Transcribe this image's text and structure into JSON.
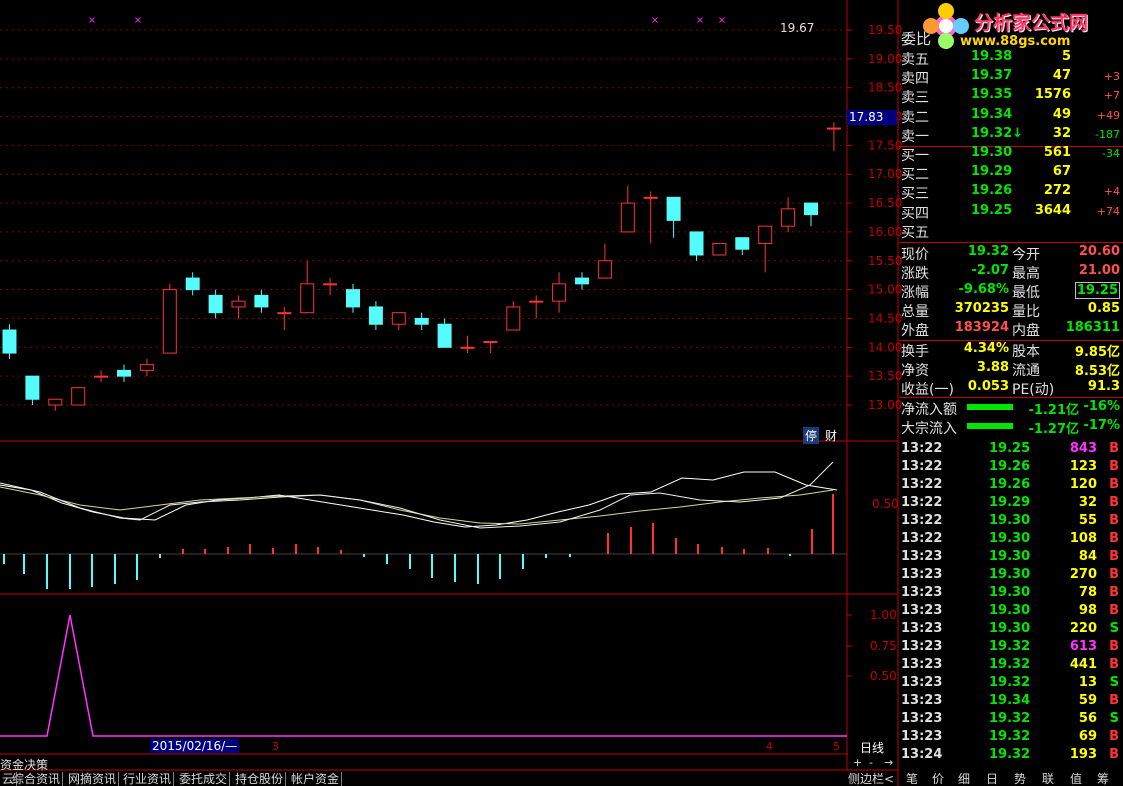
{
  "logo": {
    "title": "分析家公式网",
    "url": "www.88gs.com"
  },
  "chart": {
    "price_label_high": "19.67",
    "current_price_box": "17.83",
    "y_ticks": [
      "19.50",
      "19.00",
      "18.50",
      "18.00",
      "17.50",
      "17.00",
      "16.50",
      "16.00",
      "15.50",
      "15.00",
      "14.50",
      "14.00",
      "13.50",
      "13.00"
    ],
    "badges": [
      "停",
      "财"
    ],
    "indicator1_tick": "0.50",
    "indicator2_ticks": [
      "1.00",
      "0.75",
      "0.50"
    ],
    "date_label": "2015/02/16/—",
    "date_marks": [
      "3",
      "4",
      "5"
    ],
    "period_label": "日线",
    "panel_label": "资金决策"
  },
  "chart_data": {
    "type": "candlestick",
    "ylim": [
      12.8,
      19.7
    ],
    "candles": [
      {
        "o": 14.3,
        "c": 13.9,
        "h": 14.4,
        "l": 13.8
      },
      {
        "o": 13.5,
        "c": 13.1,
        "h": 13.5,
        "l": 13.0
      },
      {
        "o": 13.0,
        "c": 13.1,
        "h": 13.1,
        "l": 12.9
      },
      {
        "o": 13.0,
        "c": 13.3,
        "h": 13.3,
        "l": 13.0
      },
      {
        "o": 13.5,
        "c": 13.5,
        "h": 13.6,
        "l": 13.4
      },
      {
        "o": 13.6,
        "c": 13.5,
        "h": 13.7,
        "l": 13.4
      },
      {
        "o": 13.6,
        "c": 13.7,
        "h": 13.8,
        "l": 13.5
      },
      {
        "o": 13.9,
        "c": 15.0,
        "h": 15.1,
        "l": 13.9
      },
      {
        "o": 15.2,
        "c": 15.0,
        "h": 15.3,
        "l": 14.9
      },
      {
        "o": 14.9,
        "c": 14.6,
        "h": 15.0,
        "l": 14.5
      },
      {
        "o": 14.7,
        "c": 14.8,
        "h": 14.9,
        "l": 14.5
      },
      {
        "o": 14.9,
        "c": 14.7,
        "h": 15.0,
        "l": 14.6
      },
      {
        "o": 14.6,
        "c": 14.6,
        "h": 14.7,
        "l": 14.3
      },
      {
        "o": 14.6,
        "c": 15.1,
        "h": 15.5,
        "l": 14.6
      },
      {
        "o": 15.1,
        "c": 15.1,
        "h": 15.2,
        "l": 14.9
      },
      {
        "o": 15.0,
        "c": 14.7,
        "h": 15.1,
        "l": 14.6
      },
      {
        "o": 14.7,
        "c": 14.4,
        "h": 14.8,
        "l": 14.3
      },
      {
        "o": 14.4,
        "c": 14.6,
        "h": 14.6,
        "l": 14.3
      },
      {
        "o": 14.5,
        "c": 14.4,
        "h": 14.6,
        "l": 14.3
      },
      {
        "o": 14.4,
        "c": 14.0,
        "h": 14.5,
        "l": 14.0
      },
      {
        "o": 14.0,
        "c": 14.0,
        "h": 14.2,
        "l": 13.9
      },
      {
        "o": 14.1,
        "c": 14.1,
        "h": 14.1,
        "l": 13.9
      },
      {
        "o": 14.3,
        "c": 14.7,
        "h": 14.8,
        "l": 14.3
      },
      {
        "o": 14.8,
        "c": 14.8,
        "h": 14.9,
        "l": 14.5
      },
      {
        "o": 14.8,
        "c": 15.1,
        "h": 15.3,
        "l": 14.6
      },
      {
        "o": 15.2,
        "c": 15.1,
        "h": 15.3,
        "l": 15.0
      },
      {
        "o": 15.2,
        "c": 15.5,
        "h": 15.8,
        "l": 15.2
      },
      {
        "o": 16.0,
        "c": 16.5,
        "h": 16.8,
        "l": 16.0
      },
      {
        "o": 16.6,
        "c": 16.6,
        "h": 16.7,
        "l": 15.8
      },
      {
        "o": 16.6,
        "c": 16.2,
        "h": 16.6,
        "l": 15.9
      },
      {
        "o": 16.0,
        "c": 15.6,
        "h": 16.0,
        "l": 15.5
      },
      {
        "o": 15.6,
        "c": 15.8,
        "h": 15.8,
        "l": 15.6
      },
      {
        "o": 15.9,
        "c": 15.7,
        "h": 15.9,
        "l": 15.6
      },
      {
        "o": 15.8,
        "c": 16.1,
        "h": 16.1,
        "l": 15.3
      },
      {
        "o": 16.1,
        "c": 16.4,
        "h": 16.6,
        "l": 16.0
      },
      {
        "o": 16.5,
        "c": 16.3,
        "h": 16.5,
        "l": 16.1
      },
      {
        "o": 17.8,
        "c": 17.8,
        "h": 17.9,
        "l": 17.4
      }
    ],
    "panel1_yticks": [
      "0.50"
    ],
    "panel2_yticks": [
      "1.00",
      "0.75",
      "0.50"
    ]
  },
  "quote": {
    "top_partial": "委比",
    "orderbook": [
      {
        "label": "卖五",
        "price": "19.38",
        "vol": "5",
        "chg": ""
      },
      {
        "label": "卖四",
        "price": "19.37",
        "vol": "47",
        "chg": "+3"
      },
      {
        "label": "卖三",
        "price": "19.35",
        "vol": "1576",
        "chg": "+7"
      },
      {
        "label": "卖二",
        "price": "19.34",
        "vol": "49",
        "chg": "+49"
      },
      {
        "label": "卖一",
        "price": "19.32↓",
        "vol": "32",
        "chg": "-187"
      },
      {
        "label": "买一",
        "price": "19.30",
        "vol": "561",
        "chg": "-34"
      },
      {
        "label": "买二",
        "price": "19.29",
        "vol": "67",
        "chg": ""
      },
      {
        "label": "买三",
        "price": "19.26",
        "vol": "272",
        "chg": "+4"
      },
      {
        "label": "买四",
        "price": "19.25",
        "vol": "3644",
        "chg": "+74"
      },
      {
        "label": "买五",
        "price": "",
        "vol": "",
        "chg": ""
      }
    ],
    "stats": [
      {
        "l1": "现价",
        "v1": "19.32",
        "l2": "今开",
        "v2": "20.60"
      },
      {
        "l1": "涨跌",
        "v1": "-2.07",
        "l2": "最高",
        "v2": "21.00"
      },
      {
        "l1": "涨幅",
        "v1": "-9.68%",
        "l2": "最低",
        "v2": "19.25"
      },
      {
        "l1": "总量",
        "v1": "370235",
        "l2": "量比",
        "v2": "0.85"
      },
      {
        "l1": "外盘",
        "v1": "183924",
        "l2": "内盘",
        "v2": "186311"
      },
      {
        "l1": "换手",
        "v1": "4.34%",
        "l2": "股本",
        "v2": "9.85亿"
      },
      {
        "l1": "净资",
        "v1": "3.88",
        "l2": "流通",
        "v2": "8.53亿"
      },
      {
        "l1": "收益(一)",
        "v1": "0.053",
        "l2": "PE(动)",
        "v2": "91.3"
      }
    ],
    "flows": [
      {
        "label": "净流入额",
        "value": "-1.21亿",
        "pct": "-16%"
      },
      {
        "label": "大宗流入",
        "value": "-1.27亿",
        "pct": "-17%"
      }
    ],
    "ticks": [
      {
        "t": "13:22",
        "p": "19.25",
        "v": "843",
        "s": "B"
      },
      {
        "t": "13:22",
        "p": "19.26",
        "v": "123",
        "s": "B"
      },
      {
        "t": "13:22",
        "p": "19.26",
        "v": "120",
        "s": "B"
      },
      {
        "t": "13:22",
        "p": "19.29",
        "v": "32",
        "s": "B"
      },
      {
        "t": "13:22",
        "p": "19.30",
        "v": "55",
        "s": "B"
      },
      {
        "t": "13:22",
        "p": "19.30",
        "v": "108",
        "s": "B"
      },
      {
        "t": "13:23",
        "p": "19.30",
        "v": "84",
        "s": "B"
      },
      {
        "t": "13:23",
        "p": "19.30",
        "v": "270",
        "s": "B"
      },
      {
        "t": "13:23",
        "p": "19.30",
        "v": "78",
        "s": "B"
      },
      {
        "t": "13:23",
        "p": "19.30",
        "v": "98",
        "s": "B"
      },
      {
        "t": "13:23",
        "p": "19.30",
        "v": "220",
        "s": "S"
      },
      {
        "t": "13:23",
        "p": "19.32",
        "v": "613",
        "s": "B"
      },
      {
        "t": "13:23",
        "p": "19.32",
        "v": "441",
        "s": "B"
      },
      {
        "t": "13:23",
        "p": "19.32",
        "v": "13",
        "s": "S"
      },
      {
        "t": "13:23",
        "p": "19.34",
        "v": "59",
        "s": "B"
      },
      {
        "t": "13:23",
        "p": "19.32",
        "v": "56",
        "s": "S"
      },
      {
        "t": "13:23",
        "p": "19.32",
        "v": "69",
        "s": "B"
      },
      {
        "t": "13:24",
        "p": "19.32",
        "v": "193",
        "s": "B"
      }
    ]
  },
  "bottom_tabs": [
    "综合资讯",
    "网摘资讯",
    "行业资讯",
    "委托成交",
    "持仓股份",
    "帐户资金"
  ],
  "right_tabs": [
    "侧边栏<",
    "笔",
    "价",
    "细",
    "日",
    "势",
    "联",
    "值",
    "筹"
  ],
  "colors": {
    "up": "#ff3232",
    "down": "#54fcfc",
    "grid": "#800000",
    "price": "#ffff00",
    "green": "#00e600"
  }
}
